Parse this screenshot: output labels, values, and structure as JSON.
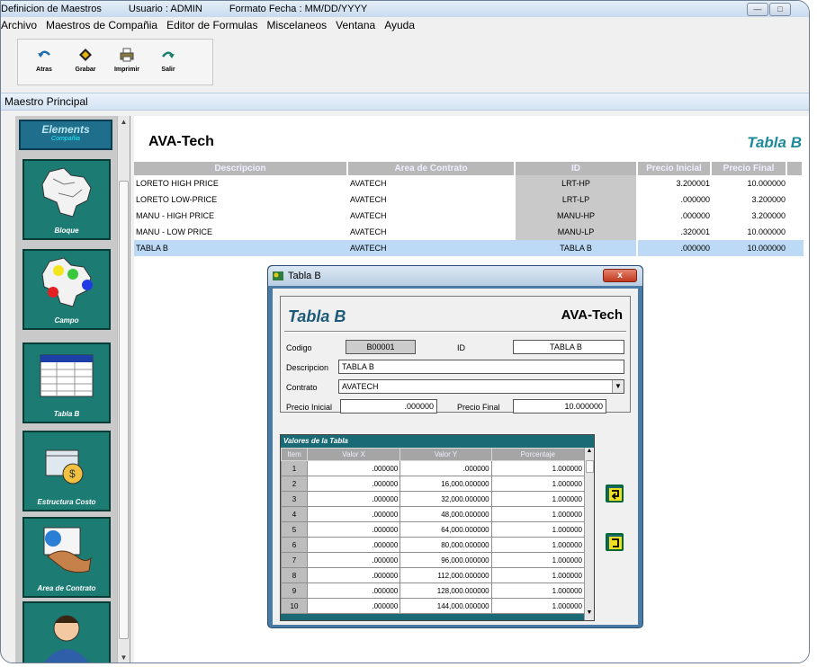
{
  "titlebar": {
    "app": "Definicion de Maestros",
    "user": "Usuario : ADMIN",
    "date_format": "Formato Fecha :  MM/DD/YYYY"
  },
  "menu": [
    "Archivo",
    "Maestros de Compañia",
    "Editor de Formulas",
    "Miscelaneos",
    "Ventana",
    "Ayuda"
  ],
  "toolbar": {
    "back": "Atras",
    "save": "Grabar",
    "print": "Imprimir",
    "exit": "Salir"
  },
  "window_label": "Maestro Principal",
  "sidebar": {
    "header_title": "Elements",
    "header_sub": "Compañia",
    "items": [
      {
        "label": "Bloque",
        "icon": "map-icon"
      },
      {
        "label": "Campo",
        "icon": "field-map-icon"
      },
      {
        "label": "Tabla B",
        "icon": "table-icon"
      },
      {
        "label": "Estructura Costo",
        "icon": "cost-structure-icon"
      },
      {
        "label": "Area de Contrato",
        "icon": "handshake-icon"
      },
      {
        "label": "",
        "icon": "person-icon"
      }
    ]
  },
  "main": {
    "company": "AVA-Tech",
    "section_title": "Tabla B",
    "columns": [
      "Descripcion",
      "Area de Contrato",
      "ID",
      "Precio Inicial",
      "Precio Final"
    ],
    "rows": [
      {
        "desc": "LORETO HIGH PRICE",
        "area": "AVATECH",
        "id": "LRT-HP",
        "pi": "3.200001",
        "pf": "10.000000"
      },
      {
        "desc": "LORETO LOW-PRICE",
        "area": "AVATECH",
        "id": "LRT-LP",
        "pi": ".000000",
        "pf": "3.200000"
      },
      {
        "desc": "MANU - HIGH PRICE",
        "area": "AVATECH",
        "id": "MANU-HP",
        "pi": ".000000",
        "pf": "3.200000"
      },
      {
        "desc": "MANU - LOW PRICE",
        "area": "AVATECH",
        "id": "MANU-LP",
        "pi": ".320001",
        "pf": "10.000000"
      },
      {
        "desc": "TABLA B",
        "area": "AVATECH",
        "id": "TABLA B",
        "pi": ".000000",
        "pf": "10.000000"
      }
    ]
  },
  "dialog": {
    "title": "Tabla B",
    "close_label": "x",
    "header_title": "Tabla B",
    "header_company": "AVA-Tech",
    "codigo_label": "Codigo",
    "codigo_value": "B00001",
    "id_label": "ID",
    "id_value": "TABLA B",
    "desc_label": "Descripcion",
    "desc_value": "TABLA B",
    "contrato_label": "Contrato",
    "contrato_value": "AVATECH",
    "pi_label": "Precio Inicial",
    "pi_value": ".000000",
    "pf_label": "Precio Final",
    "pf_value": "10.000000",
    "values_title": "Valores de la Tabla",
    "values_columns": [
      "Item",
      "Valor X",
      "Valor Y",
      "Porcentaje"
    ],
    "values": [
      [
        "1",
        ".000000",
        ".000000",
        "1.000000"
      ],
      [
        "2",
        ".000000",
        "16,000.000000",
        "1.000000"
      ],
      [
        "3",
        ".000000",
        "32,000.000000",
        "1.000000"
      ],
      [
        "4",
        ".000000",
        "48,000.000000",
        "1.000000"
      ],
      [
        "5",
        ".000000",
        "64,000.000000",
        "1.000000"
      ],
      [
        "6",
        ".000000",
        "80,000.000000",
        "1.000000"
      ],
      [
        "7",
        ".000000",
        "96,000.000000",
        "1.000000"
      ],
      [
        "8",
        ".000000",
        "112,000.000000",
        "1.000000"
      ],
      [
        "9",
        ".000000",
        "128,000.000000",
        "1.000000"
      ],
      [
        "10",
        ".000000",
        "144,000.000000",
        "1.000000"
      ]
    ]
  }
}
